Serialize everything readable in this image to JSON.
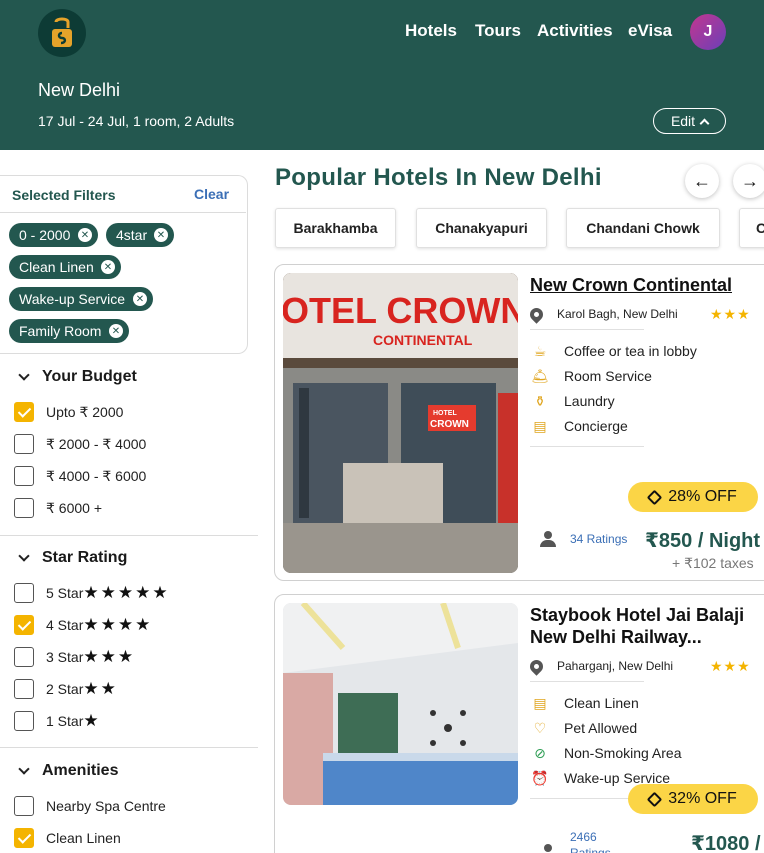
{
  "header": {
    "nav": [
      "Hotels",
      "Tours",
      "Activities",
      "eVisa"
    ],
    "avatar_initial": "J",
    "city": "New Delhi",
    "search_summary": "17 Jul - 24 Jul, 1 room, 2 Adults",
    "edit_label": "Edit"
  },
  "filters": {
    "title": "Selected Filters",
    "clear_label": "Clear",
    "chips": [
      "0 - 2000",
      "4star",
      "Clean Linen",
      "Wake-up Service",
      "Family Room"
    ]
  },
  "budget": {
    "title": "Your Budget",
    "options": [
      {
        "label": "Upto ₹ 2000",
        "checked": true
      },
      {
        "label": "₹ 2000 - ₹ 4000",
        "checked": false
      },
      {
        "label": "₹ 4000 - ₹ 6000",
        "checked": false
      },
      {
        "label": "₹ 6000 +",
        "checked": false
      }
    ]
  },
  "star_rating": {
    "title": "Star Rating",
    "options": [
      {
        "label": "5 Star",
        "stars": 5,
        "checked": false
      },
      {
        "label": "4 Star",
        "stars": 4,
        "checked": true
      },
      {
        "label": "3 Star",
        "stars": 3,
        "checked": false
      },
      {
        "label": "2 Star",
        "stars": 2,
        "checked": false
      },
      {
        "label": "1 Star",
        "stars": 1,
        "checked": false
      }
    ]
  },
  "amenities": {
    "title": "Amenities",
    "options": [
      {
        "label": "Nearby Spa Centre",
        "checked": false
      },
      {
        "label": "Clean Linen",
        "checked": true
      }
    ]
  },
  "main": {
    "title": "Popular Hotels In New Delhi",
    "locality_tabs": [
      "Barakhamba",
      "Chanakyapuri",
      "Chandani Chowk",
      "C"
    ]
  },
  "hotels": [
    {
      "name": "New Crown Continental",
      "location": "Karol Bagh, New Delhi",
      "stars": "★★★",
      "amenities": [
        "Coffee or tea in lobby",
        "Room Service",
        "Laundry",
        "Concierge"
      ],
      "amenity_icons": [
        "coffee-cup-icon",
        "room-service-bell-icon",
        "laundry-icon",
        "concierge-icon"
      ],
      "discount": "28% OFF",
      "ratings": "34 Ratings",
      "price": "₹850 / Night",
      "taxes": "+ ₹102 taxes",
      "sign_text_1": "OTEL CROWN",
      "sign_text_2": "CONTINENTAL",
      "sign_text_3": "HOTEL",
      "sign_text_4": "CROWN"
    },
    {
      "name": "Staybook Hotel Jai Balaji New Delhi Railway...",
      "location": "Paharganj, New Delhi",
      "stars": "★★★",
      "amenities": [
        "Clean Linen",
        "Pet Allowed",
        "Non-Smoking Area",
        "Wake-up Service"
      ],
      "amenity_icons": [
        "linen-icon",
        "pet-icon",
        "no-smoking-icon",
        "alarm-clock-icon"
      ],
      "discount": "32% OFF",
      "ratings": "2466 Ratings",
      "price": "₹1080 /"
    }
  ],
  "colors": {
    "brand_green": "#23574f",
    "accent_yellow": "#fbd546",
    "star_gold": "#f4b400",
    "link_blue": "#3b6fb6"
  }
}
